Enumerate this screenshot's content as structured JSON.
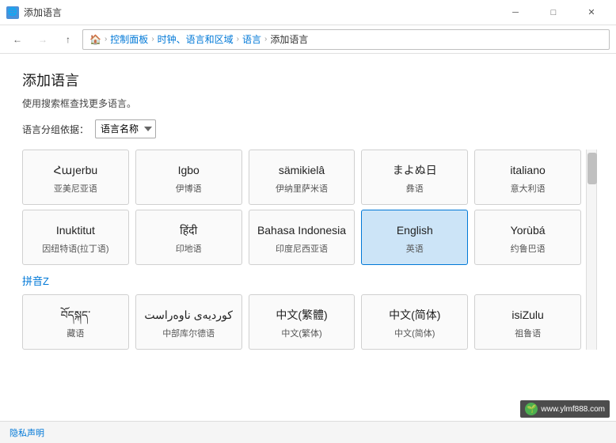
{
  "titlebar": {
    "icon": "🌐",
    "title": "添加语言",
    "controls": {
      "minimize": "─",
      "maximize": "□",
      "close": "✕"
    }
  },
  "navbar": {
    "back": "←",
    "forward": "→",
    "up": "↑",
    "breadcrumb": [
      "控制面板",
      "时钟、语言和区域",
      "语言",
      "添加语言"
    ],
    "breadcrumb_sep": "›"
  },
  "page": {
    "title": "添加语言",
    "subtitle": "使用搜索框查找更多语言。",
    "filter_label": "语言分组依据：",
    "filter_value": "语言名称"
  },
  "sections": [
    {
      "id": "section_none",
      "label": "",
      "languages": [
        {
          "native": "Հայerbu",
          "chinese": "亚美尼亚语",
          "selected": false
        },
        {
          "native": "Igbo",
          "chinese": "伊博语",
          "selected": false
        },
        {
          "native": "sämikielâ",
          "chinese": "伊纳里萨米语",
          "selected": false
        },
        {
          "native": "まよぬ日",
          "chinese": "彝语",
          "selected": false
        },
        {
          "native": "italiano",
          "chinese": "意大利语",
          "selected": false
        }
      ]
    },
    {
      "id": "section_none2",
      "label": "",
      "languages": [
        {
          "native": "Inuktitut",
          "chinese": "因纽特语(拉丁语)",
          "selected": false
        },
        {
          "native": "हिंदी",
          "chinese": "印地语",
          "selected": false
        },
        {
          "native": "Bahasa Indonesia",
          "chinese": "印度尼西亚语",
          "selected": false
        },
        {
          "native": "English",
          "chinese": "英语",
          "selected": true
        },
        {
          "native": "Yorùbá",
          "chinese": "约鲁巴语",
          "selected": false
        }
      ]
    },
    {
      "id": "section_z",
      "label": "拼音Z",
      "languages": [
        {
          "native": "བོདསྐད་",
          "chinese": "藏语",
          "selected": false
        },
        {
          "native": "كوردیەی ناوەراست",
          "chinese": "中部库尔德语",
          "selected": false
        },
        {
          "native": "中文(繁體)",
          "chinese": "中文(繁体)",
          "selected": false
        },
        {
          "native": "中文(简体)",
          "chinese": "中文(简体)",
          "selected": false
        },
        {
          "native": "isiZulu",
          "chinese": "祖鲁语",
          "selected": false
        }
      ]
    }
  ],
  "statusbar": {
    "privacy_label": "隐私声明"
  },
  "watermark": {
    "icon": "🌱",
    "text": "www.ylmf888.com"
  }
}
